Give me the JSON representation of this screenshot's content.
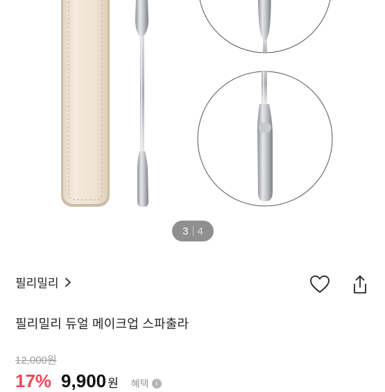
{
  "pager": {
    "current": "3",
    "total": "4"
  },
  "brand": {
    "name": "필리밀리"
  },
  "product": {
    "title": "필리밀리 듀얼 메이크업 스파출라",
    "original_price": "12,000원",
    "discount": "17%",
    "sale_price": "9,900",
    "currency": "원",
    "benefit_label": "혜택"
  },
  "icons": {
    "brand_chevron": "chevron-right-icon",
    "wishlist": "heart-icon",
    "share": "share-icon",
    "benefit_info": "info-icon"
  },
  "colors": {
    "discount": "#f0475b",
    "pager_bg": "#8f8f8f",
    "pouch": "#efe4d4"
  }
}
